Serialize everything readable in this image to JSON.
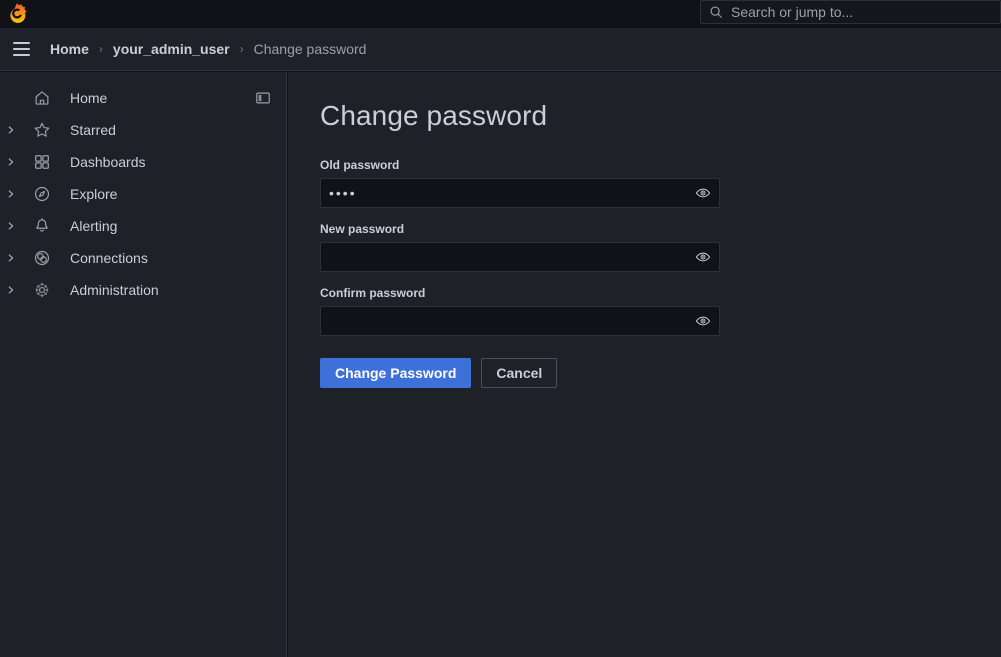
{
  "app": {
    "name": "Grafana",
    "logo_icon": "grafana-logo-icon",
    "theme_bg": "#1f2128",
    "accent_color": "#3d71d9"
  },
  "search": {
    "placeholder": "Search or jump to...",
    "value": "",
    "icon": "search-icon"
  },
  "topnav": {
    "menu_icon": "hamburger-menu-icon",
    "breadcrumbs": [
      {
        "label": "Home",
        "current": false
      },
      {
        "label": "your_admin_user",
        "current": false
      },
      {
        "label": "Change password",
        "current": true
      }
    ],
    "separator": "›"
  },
  "sidebar": {
    "dock_icon": "dock-menu-icon",
    "expand_icon": "chevron-right-icon",
    "items": [
      {
        "label": "Home",
        "icon": "home-icon",
        "expandable": false
      },
      {
        "label": "Starred",
        "icon": "star-icon",
        "expandable": true
      },
      {
        "label": "Dashboards",
        "icon": "dashboards-grid-icon",
        "expandable": true
      },
      {
        "label": "Explore",
        "icon": "compass-icon",
        "expandable": true
      },
      {
        "label": "Alerting",
        "icon": "bell-icon",
        "expandable": true
      },
      {
        "label": "Connections",
        "icon": "connections-icon",
        "expandable": true
      },
      {
        "label": "Administration",
        "icon": "gear-icon",
        "expandable": true
      }
    ]
  },
  "main": {
    "title": "Change password",
    "fields": [
      {
        "label": "Old password",
        "value": "••••",
        "placeholder": "",
        "reveal_icon": "eye-icon"
      },
      {
        "label": "New password",
        "value": "",
        "placeholder": "",
        "reveal_icon": "eye-icon"
      },
      {
        "label": "Confirm password",
        "value": "",
        "placeholder": "",
        "reveal_icon": "eye-icon"
      }
    ],
    "submit_label": "Change Password",
    "cancel_label": "Cancel"
  }
}
